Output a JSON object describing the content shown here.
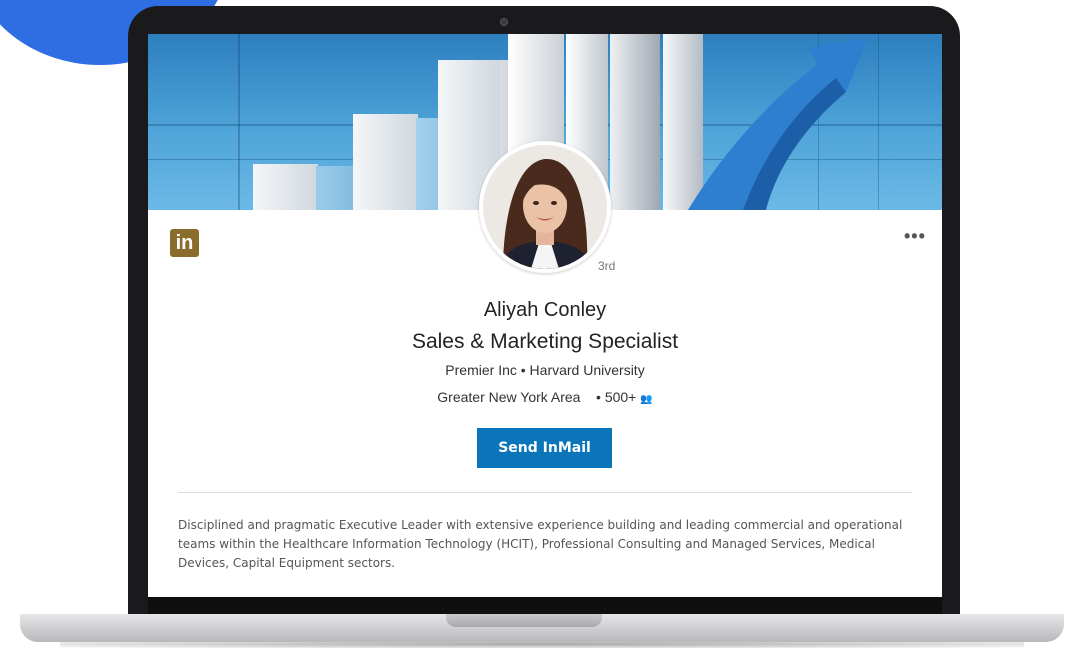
{
  "profile": {
    "name": "Aliyah Conley",
    "headline": "Sales & Marketing Specialist",
    "company_line": "Premier Inc • Harvard University",
    "location": "Greater New York Area",
    "connections": "• 500+",
    "connection_icon": "people-icon",
    "degree": "3rd",
    "summary": "Disciplined and pragmatic Executive Leader with extensive experience building and leading commercial and operational teams within the Healthcare Information Technology (HCIT), Professional Consulting and Managed Services, Medical Devices, Capital Equipment sectors."
  },
  "actions": {
    "send_label": "Send InMail",
    "more_label": "•••"
  },
  "brand": {
    "logo_text": "in",
    "logo_color": "#8a6d2c",
    "accent": "#0a75b8",
    "blob_color": "#2f6de3"
  }
}
